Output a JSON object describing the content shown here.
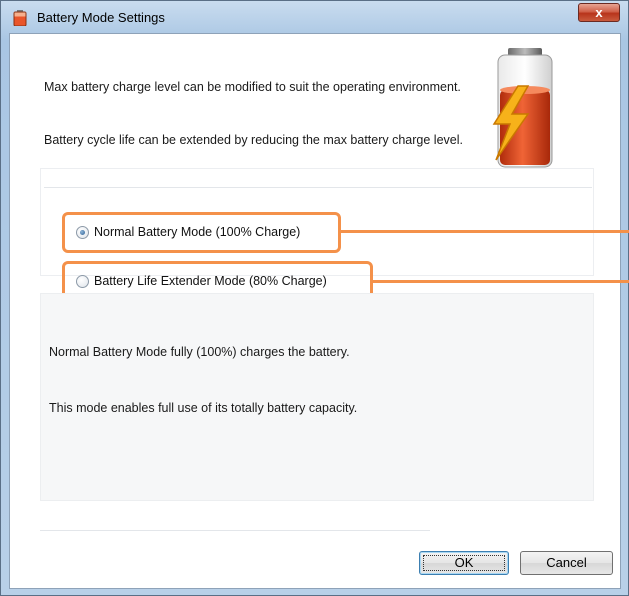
{
  "window": {
    "title": "Battery Mode Settings",
    "close_label": "x"
  },
  "description": {
    "line1": "Max battery charge level can be modified to suit the operating environment.",
    "line2": "Battery cycle life can be extended by reducing the max battery charge level."
  },
  "options": [
    {
      "label": "Normal Battery Mode (100% Charge)",
      "checked": true
    },
    {
      "label": "Battery Life Extender Mode (80% Charge)",
      "checked": false
    }
  ],
  "info": {
    "line1": "Normal Battery Mode fully (100%) charges the battery.",
    "line2": "This mode enables full use of its totally battery capacity."
  },
  "buttons": {
    "ok": "OK",
    "cancel": "Cancel"
  },
  "colors": {
    "highlight": "#f4914a",
    "battery_fill": "#e8471a",
    "lightning": "#f7b21a"
  },
  "icons": {
    "app": "battery-icon",
    "hero": "battery-charging-icon"
  }
}
